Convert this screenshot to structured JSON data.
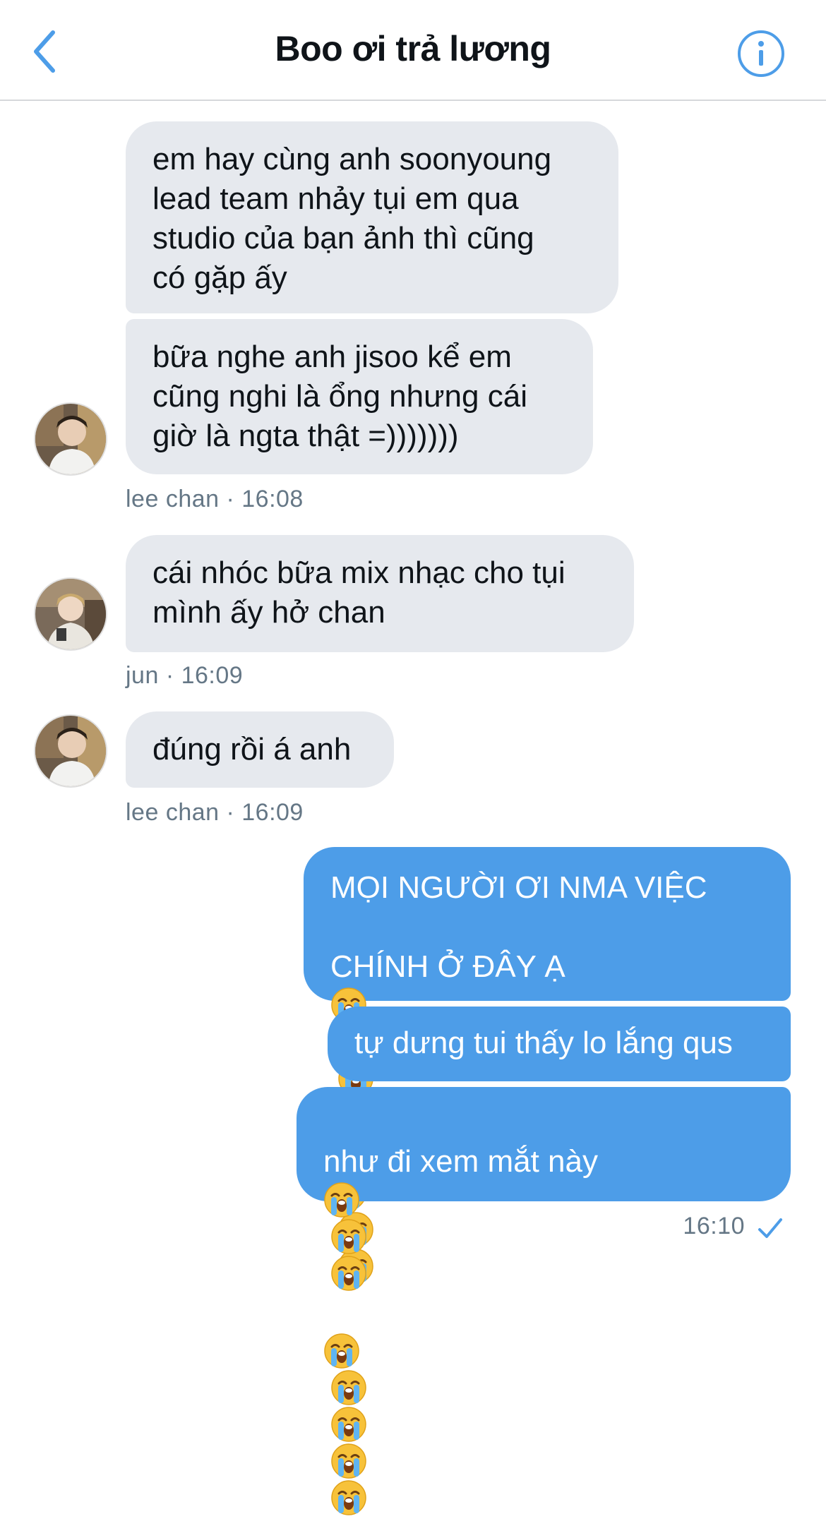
{
  "header": {
    "title": "Boo ơi trả lương"
  },
  "messages": [
    {
      "sender": "lee chan",
      "text": "em hay cùng anh soonyoung\nlead team nhảy tụi em qua\nstudio của bạn ảnh thì cũng\ncó gặp ấy"
    },
    {
      "sender": "lee chan",
      "text": "bữa nghe anh jisoo kể em\ncũng nghi là ổng nhưng cái\ngiờ là ngta thật =)))))))"
    },
    {
      "meta": "lee chan · 16:08"
    },
    {
      "sender": "jun",
      "text": "cái nhóc bữa mix nhạc cho tụi\nmình ấy hở chan"
    },
    {
      "meta": "jun · 16:09"
    },
    {
      "sender": "lee chan",
      "text": "đúng rồi á anh"
    },
    {
      "meta": "lee chan · 16:09"
    },
    {
      "sender": "me",
      "text_line1": "MỌI NGƯỜI ƠI NMA VIỆC",
      "text_line2": "CHÍNH Ở ĐÂY Ạ",
      "emoji": "loudly-crying-face",
      "emoji_count": 7
    },
    {
      "sender": "me",
      "text": "tự dưng tui thấy lo lắng qus"
    },
    {
      "sender": "me",
      "text": "như đi xem mắt này",
      "emoji": "loudly-crying-face",
      "emoji_count": 8
    },
    {
      "meta": "16:10"
    }
  ],
  "colors": {
    "incoming_bubble": "#e6e9ee",
    "outgoing_bubble": "#4d9de8",
    "accent": "#1d9bf0",
    "meta_text": "#657786"
  },
  "icons": {
    "back": "chevron-left-icon",
    "info": "info-circle-icon",
    "sent": "checkmark-icon"
  }
}
